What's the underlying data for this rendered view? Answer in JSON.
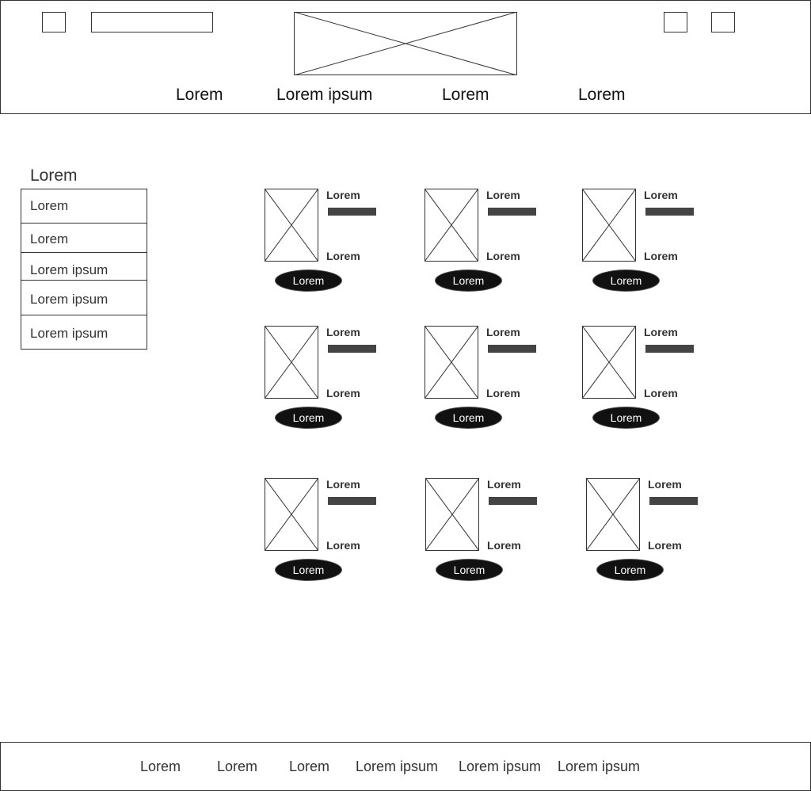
{
  "header": {
    "nav": [
      "Lorem",
      "Lorem ipsum",
      "Lorem",
      "Lorem"
    ]
  },
  "sidebar": {
    "title": "Lorem",
    "items": [
      "Lorem",
      "Lorem",
      "Lorem ipsum",
      "Lorem ipsum",
      "Lorem ipsum"
    ]
  },
  "products": [
    {
      "title": "Lorem",
      "subtitle": "Lorem",
      "button": "Lorem"
    },
    {
      "title": "Lorem",
      "subtitle": "Lorem",
      "button": "Lorem"
    },
    {
      "title": "Lorem",
      "subtitle": "Lorem",
      "button": "Lorem"
    },
    {
      "title": "Lorem",
      "subtitle": "Lorem",
      "button": "Lorem"
    },
    {
      "title": "Lorem",
      "subtitle": "Lorem",
      "button": "Lorem"
    },
    {
      "title": "Lorem",
      "subtitle": "Lorem",
      "button": "Lorem"
    },
    {
      "title": "Lorem",
      "subtitle": "Lorem",
      "button": "Lorem"
    },
    {
      "title": "Lorem",
      "subtitle": "Lorem",
      "button": "Lorem"
    },
    {
      "title": "Lorem",
      "subtitle": "Lorem",
      "button": "Lorem"
    }
  ],
  "footer": {
    "links": [
      "Lorem",
      "Lorem",
      "Lorem",
      "Lorem ipsum",
      "Lorem ipsum",
      "Lorem ipsum"
    ]
  },
  "icons": {
    "header_left": "menu-icon",
    "header_right_1": "user-icon",
    "header_right_2": "cart-icon",
    "logo": "logo-placeholder",
    "product_image": "image-placeholder"
  },
  "colors": {
    "button_bg": "#111111",
    "bar": "#444444",
    "border": "#333333"
  }
}
